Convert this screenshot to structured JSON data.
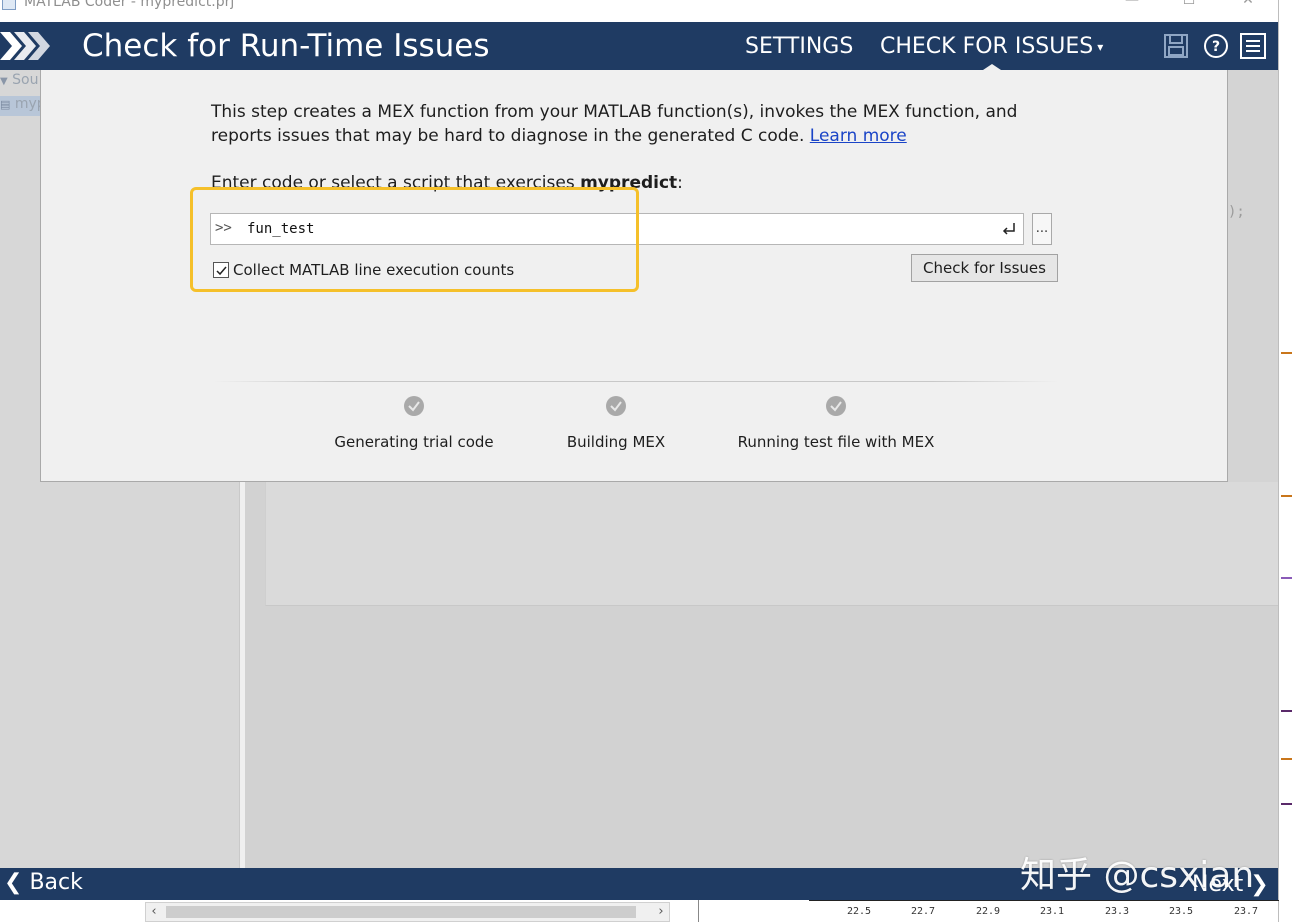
{
  "window": {
    "title": "MATLAB Coder - mypredict.prj",
    "minimize_glyph": "—",
    "maximize_glyph": "☐",
    "close_glyph": "✕"
  },
  "header": {
    "title": "Check for Run-Time Issues",
    "tabs": [
      {
        "label": "SETTINGS",
        "active": false
      },
      {
        "label": "CHECK FOR ISSUES",
        "active": true,
        "caret": "▾"
      }
    ],
    "icons": [
      "save-icon",
      "help-icon",
      "menu-icon"
    ]
  },
  "sidebar": {
    "items": [
      {
        "label": "Sou"
      },
      {
        "label": "myp"
      }
    ]
  },
  "background": {
    "code_fragment": ");"
  },
  "dialog": {
    "description": "This step creates a MEX function from your MATLAB function(s), invokes the MEX function, and reports issues that may be hard to diagnose in the generated C code.",
    "learn_more": "Learn more",
    "prompt_prefix": "Enter code or select a script that exercises ",
    "function_name": "mypredict",
    "prompt_suffix": ":",
    "command_prompt": ">>",
    "command_value": "fun_test",
    "browse_label": "...",
    "checkbox_label": "Collect MATLAB line execution counts",
    "checkbox_checked": true,
    "check_button": "Check for Issues",
    "steps": [
      {
        "label": "Generating trial code"
      },
      {
        "label": "Building MEX"
      },
      {
        "label": "Running test file with MEX"
      }
    ]
  },
  "footer": {
    "back_label": "Back",
    "next_label": "Next"
  },
  "axis_ticks": [
    "22.5",
    "22.7",
    "22.9",
    "23.1",
    "23.3",
    "23.5",
    "23.7"
  ],
  "watermark": "知乎 @csxian",
  "colors": {
    "banner": "#1f3b63",
    "highlight": "#f5c02a",
    "link": "#1a44c7"
  }
}
